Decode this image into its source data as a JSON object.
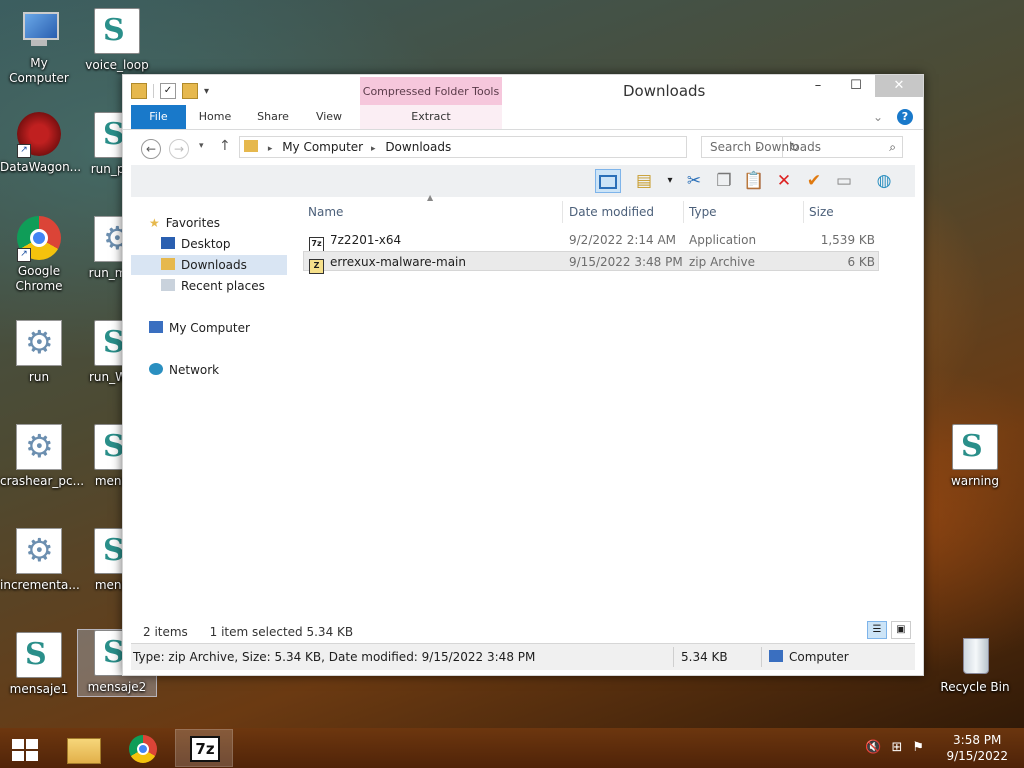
{
  "desktop": {
    "icons": [
      {
        "label": "My Computer"
      },
      {
        "label": "voice_loop"
      },
      {
        "label": "DataWagon..."
      },
      {
        "label": "run_pa..."
      },
      {
        "label": "Google Chrome"
      },
      {
        "label": "run_me..."
      },
      {
        "label": "run"
      },
      {
        "label": "run_Wa..."
      },
      {
        "label": "crashear_pc..."
      },
      {
        "label": "mens..."
      },
      {
        "label": "incrementa..."
      },
      {
        "label": "mens..."
      },
      {
        "label": "mensaje1"
      },
      {
        "label": "mensaje2"
      },
      {
        "label": "warning"
      },
      {
        "label": "Recycle Bin"
      }
    ]
  },
  "window": {
    "title": "Downloads",
    "context_group": "Compressed Folder Tools",
    "tabs": {
      "file": "File",
      "home": "Home",
      "share": "Share",
      "view": "View",
      "extract": "Extract"
    },
    "breadcrumbs": [
      "My Computer",
      "Downloads"
    ],
    "search_placeholder": "Search Downloads",
    "navigation": {
      "favorites": "Favorites",
      "desktop": "Desktop",
      "downloads": "Downloads",
      "recent": "Recent places",
      "computer": "My Computer",
      "network": "Network"
    },
    "columns": {
      "name": "Name",
      "date": "Date modified",
      "type": "Type",
      "size": "Size"
    },
    "files": [
      {
        "name": "7z2201-x64",
        "date": "9/2/2022 2:14 AM",
        "type": "Application",
        "size": "1,539 KB"
      },
      {
        "name": "errexux-malware-main",
        "date": "9/15/2022 3:48 PM",
        "type": "zip Archive",
        "size": "6 KB"
      }
    ],
    "status": {
      "items": "2 items",
      "selected": "1 item selected  5.34 KB"
    },
    "details": {
      "description": "Type: zip Archive, Size: 5.34 KB, Date modified: 9/15/2022 3:48 PM",
      "size": "5.34 KB",
      "location": "Computer"
    }
  },
  "taskbar": {
    "z7_label": "7z",
    "time": "3:58 PM",
    "date": "9/15/2022"
  },
  "colors": {
    "accent": "#1979ca",
    "context_tab": "#f6c7dc"
  }
}
